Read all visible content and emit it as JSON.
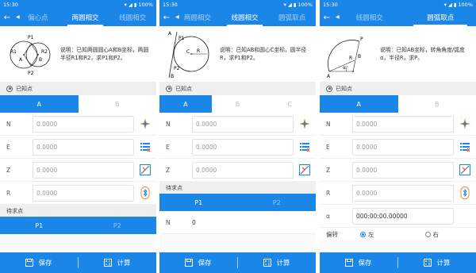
{
  "status": {
    "time": "15:30",
    "battery": "100%"
  },
  "screens": [
    {
      "tabs": [
        "偏心点",
        "两圆相交",
        "线圆相交"
      ],
      "active_tab": 1,
      "description": [
        "说明：已知两圆圆心A和B坐标，两圆",
        "半径R1和R2，求P1和P2。"
      ],
      "diagram_labels": {
        "p1": "P1",
        "p2": "P2",
        "r1": "R1",
        "r2": "R2",
        "a": "A",
        "b": "B"
      },
      "known_label": "已知点",
      "known_tabs": [
        "A",
        "B"
      ],
      "fields": [
        {
          "label": "N",
          "value": "0.0000"
        },
        {
          "label": "E",
          "value": "0.0000"
        },
        {
          "label": "Z",
          "value": "0.0000"
        },
        {
          "label": "R",
          "value": "0.0000"
        }
      ],
      "result_label": "待求点",
      "result_tabs": [
        "P1",
        "P2"
      ],
      "save": "保存",
      "calc": "计算"
    },
    {
      "tabs": [
        "两圆相交",
        "线圆相交",
        "圆弧取点"
      ],
      "active_tab": 1,
      "description": [
        "说明：已知AB和圆心C坐标，圆半径",
        "R，求P1和P2。"
      ],
      "diagram_labels": {
        "a": "A",
        "p1": "P1",
        "c": "C",
        "r": "R",
        "p2": "P2",
        "b": "B"
      },
      "known_label": "已知点",
      "known_tabs": [
        "A",
        "B",
        "C"
      ],
      "fields": [
        {
          "label": "N",
          "value": "0.0000"
        },
        {
          "label": "E",
          "value": "0.0000"
        },
        {
          "label": "Z",
          "value": "0.0000"
        }
      ],
      "result_label": "待求点",
      "result_tabs": [
        "P1",
        "P2"
      ],
      "result_field": {
        "label": "N",
        "value": "0"
      },
      "save": "保存",
      "calc": "计算"
    },
    {
      "tabs": [
        "线圆相交",
        "圆弧取点"
      ],
      "active_tab": 1,
      "description": [
        "说明：已知AB坐标，转角角度/弧度",
        "α，半径R，求P。"
      ],
      "diagram_labels": {
        "p": "P",
        "b": "B",
        "r": "R",
        "alpha": "α",
        "a": "A"
      },
      "known_label": "已知点",
      "known_tabs": [
        "A",
        "B"
      ],
      "fields": [
        {
          "label": "N",
          "value": "0.0000"
        },
        {
          "label": "E",
          "value": "0.0000"
        },
        {
          "label": "Z",
          "value": "0.0000"
        },
        {
          "label": "R",
          "value": "0.0000"
        },
        {
          "label": "α",
          "value": "000:00:00.00000"
        }
      ],
      "direction_label": "偏转",
      "direction_left": "左",
      "direction_right": "右",
      "save": "保存",
      "calc": "计算"
    }
  ],
  "colors": {
    "primary": "#1a86e8"
  }
}
